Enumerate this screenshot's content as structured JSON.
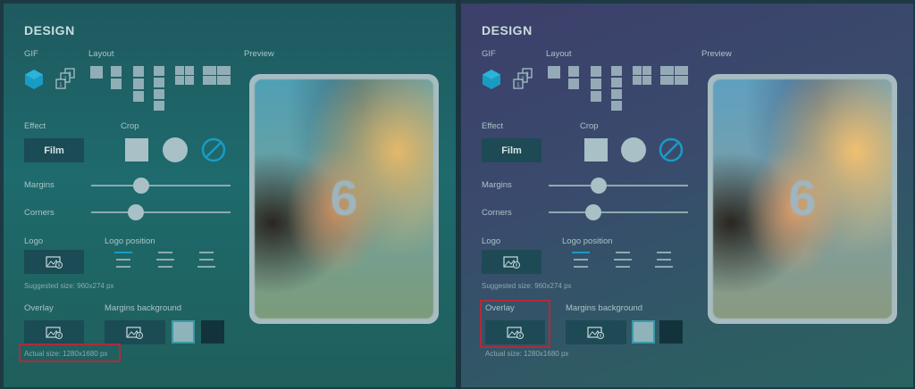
{
  "panels": [
    {
      "title": "DESIGN",
      "gif_label": "GIF",
      "layout_label": "Layout",
      "preview_label": "Preview",
      "effect_label": "Effect",
      "effect_button": "Film",
      "crop_label": "Crop",
      "margins_label": "Margins",
      "corners_label": "Corners",
      "margins_value": 0.36,
      "corners_value": 0.32,
      "logo_label": "Logo",
      "logo_position_label": "Logo position",
      "suggested_size": "Suggested size: 960x274 px",
      "overlay_label": "Overlay",
      "margins_background_label": "Margins background",
      "actual_size": "Actual size: 1280x1680 px",
      "countdown": "6",
      "highlight": "actual-size"
    },
    {
      "title": "DESIGN",
      "gif_label": "GIF",
      "layout_label": "Layout",
      "preview_label": "Preview",
      "effect_label": "Effect",
      "effect_button": "Film",
      "crop_label": "Crop",
      "margins_label": "Margins",
      "corners_label": "Corners",
      "margins_value": 0.36,
      "corners_value": 0.32,
      "logo_label": "Logo",
      "logo_position_label": "Logo position",
      "suggested_size": "Suggested size: 960x274 px",
      "overlay_label": "Overlay",
      "margins_background_label": "Margins background",
      "actual_size": "Actual size: 1280x1680 px",
      "countdown": "6",
      "highlight": "overlay"
    }
  ],
  "colors": {
    "accent": "#1a9bc4",
    "highlight": "#b22a3a",
    "swatch_light": "#8fb3ba",
    "swatch_dark": "#12333b"
  },
  "icons": {
    "gif": "gif-hexagon-icon",
    "stack": "photo-stack-icon",
    "upload": "image-upload-icon",
    "crop_none": "no-crop-icon"
  }
}
